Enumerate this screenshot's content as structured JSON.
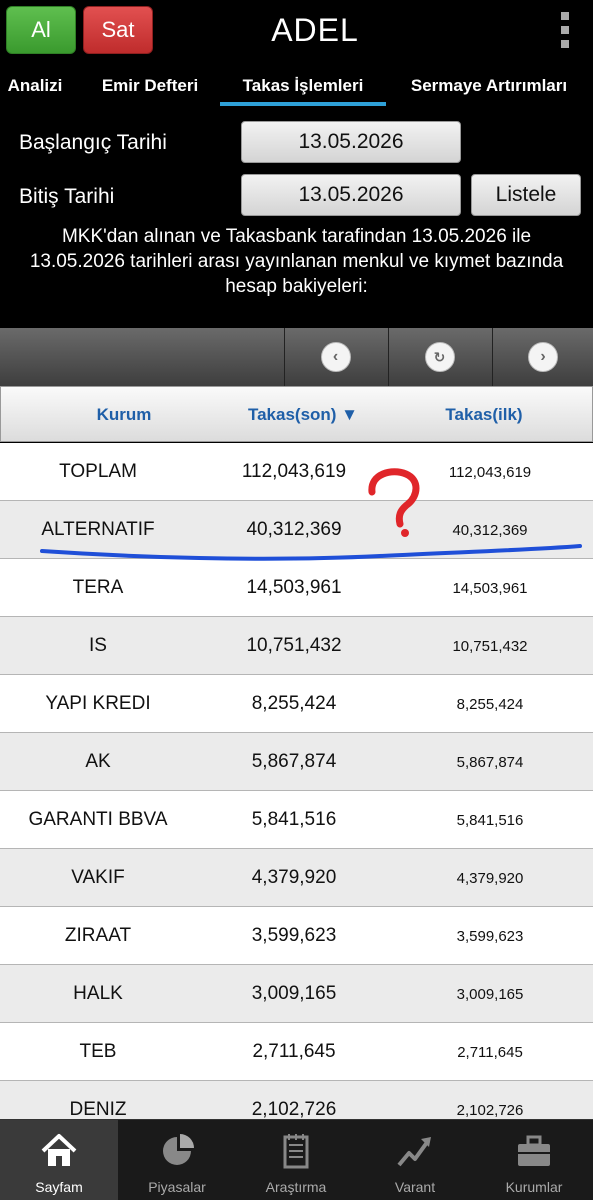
{
  "header": {
    "buy_label": "Al",
    "sell_label": "Sat",
    "title": "ADEL"
  },
  "tabs": [
    {
      "label": "Analizi"
    },
    {
      "label": "Emir Defteri"
    },
    {
      "label": "Takas İşlemleri",
      "active": true
    },
    {
      "label": "Sermaye Artırımları"
    }
  ],
  "form": {
    "start_label": "Başlangıç Tarihi",
    "start_value": "13.05.2026",
    "end_label": "Bitiş Tarihi",
    "end_value": "13.05.2026",
    "list_button": "Listele",
    "info_text": "MKK'dan alınan ve Takasbank tarafindan  13.05.2026  ile 13.05.2026  tarihleri arası yayınlanan menkul ve kıymet bazında hesap bakiyeleri:"
  },
  "table": {
    "columns": [
      "Kurum",
      "Takas(son) ▼",
      "Takas(ilk)"
    ],
    "rows": [
      [
        "TOPLAM",
        "112,043,619",
        "112,043,619"
      ],
      [
        "ALTERNATIF",
        "40,312,369",
        "40,312,369"
      ],
      [
        "TERA",
        "14,503,961",
        "14,503,961"
      ],
      [
        "IS",
        "10,751,432",
        "10,751,432"
      ],
      [
        "YAPI KREDI",
        "8,255,424",
        "8,255,424"
      ],
      [
        "AK",
        "5,867,874",
        "5,867,874"
      ],
      [
        "GARANTI BBVA",
        "5,841,516",
        "5,841,516"
      ],
      [
        "VAKIF",
        "4,379,920",
        "4,379,920"
      ],
      [
        "ZIRAAT",
        "3,599,623",
        "3,599,623"
      ],
      [
        "HALK",
        "3,009,165",
        "3,009,165"
      ],
      [
        "TEB",
        "2,711,645",
        "2,711,645"
      ],
      [
        "DENIZ",
        "2,102,726",
        "2,102,726"
      ]
    ]
  },
  "bottom_nav": [
    {
      "label": "Sayfam",
      "icon": "home-icon",
      "active": true
    },
    {
      "label": "Piyasalar",
      "icon": "pie-chart-icon"
    },
    {
      "label": "Araştırma",
      "icon": "notepad-icon"
    },
    {
      "label": "Varant",
      "icon": "trend-chart-icon"
    },
    {
      "label": "Kurumlar",
      "icon": "briefcase-icon"
    }
  ],
  "colors": {
    "accent": "#2ea0d8",
    "buy": "#3a9a2e",
    "sell": "#bf2c2c",
    "column_header_text": "#1f5fa8",
    "annotation_red": "#e0262a",
    "annotation_blue": "#1f4fd8"
  }
}
